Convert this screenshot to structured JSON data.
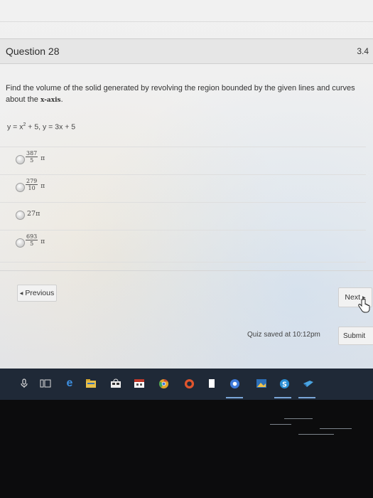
{
  "question": {
    "title": "Question 28",
    "points": "3.4",
    "prompt_before": "Find the volume of the solid generated by revolving the region bounded by the given lines and curves about the ",
    "axis_label": "x-axis",
    "prompt_after": ".",
    "equation_prefix": "y = x",
    "equation_exp": "2",
    "equation_suffix": " + 5, y = 3x + 5"
  },
  "answers": [
    {
      "numerator": "387",
      "denominator": "5",
      "pi": "π"
    },
    {
      "numerator": "279",
      "denominator": "10",
      "pi": "π"
    },
    {
      "text": "27π"
    },
    {
      "numerator": "693",
      "denominator": "5",
      "pi": "π"
    }
  ],
  "nav": {
    "previous_label": "Previous",
    "next_label": "Next",
    "saved_text": "Quiz saved at 10:12pm",
    "submit_label": "Submit"
  },
  "colors": {
    "background": "#eeeeee",
    "header": "#e6e6e6",
    "taskbar": "#1f2937"
  },
  "taskbar_icons": [
    "microphone-icon",
    "task-view-icon",
    "edge-browser-icon",
    "file-explorer-icon",
    "store-icon",
    "calendar-icon",
    "chrome-icon",
    "office-icon",
    "notes-icon",
    "chrome-profile-icon",
    "photos-icon",
    "skype-icon",
    "mail-icon"
  ]
}
